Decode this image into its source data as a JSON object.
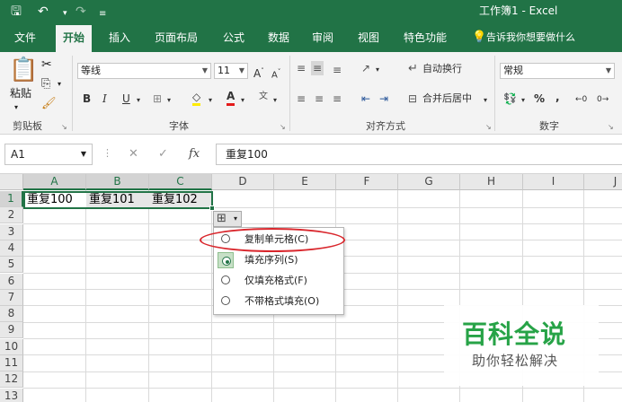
{
  "titlebar": {
    "title": "工作簿1  -  Excel",
    "save_icon": "save-icon",
    "undo_icon": "undo-icon",
    "redo_icon": "redo-icon",
    "customize_icon": "customize-toolbar-icon"
  },
  "tabs": [
    "文件",
    "开始",
    "插入",
    "页面布局",
    "公式",
    "数据",
    "审阅",
    "视图",
    "特色功能"
  ],
  "tell_me": "告诉我你想要做什么",
  "ribbon": {
    "clipboard": {
      "paste_label": "粘贴",
      "group_label": "剪贴板"
    },
    "font": {
      "font_name": "等线",
      "font_size": "11",
      "bold": "B",
      "italic": "I",
      "underline": "U",
      "grow": "A",
      "shrink": "A",
      "group_label": "字体"
    },
    "alignment": {
      "wrap_text": "自动换行",
      "merge_center": "合并后居中",
      "group_label": "对齐方式"
    },
    "number": {
      "format": "常规",
      "percent": "%",
      "comma": ",",
      "group_label": "数字"
    }
  },
  "formula_bar": {
    "name_box": "A1",
    "fx": "fx",
    "value": "重复100"
  },
  "grid": {
    "columns": [
      "A",
      "B",
      "C",
      "D",
      "E",
      "F",
      "G",
      "H",
      "I",
      "J"
    ],
    "rows": [
      "1",
      "2",
      "3",
      "4",
      "5",
      "6",
      "7",
      "8",
      "9",
      "10",
      "11",
      "12",
      "13"
    ],
    "cells": {
      "A1": "重复100",
      "B1": "重复101",
      "C1": "重复102"
    }
  },
  "autofill_menu": {
    "items": [
      {
        "label": "复制单元格(C)",
        "checked": false
      },
      {
        "label": "填充序列(S)",
        "checked": true
      },
      {
        "label": "仅填充格式(F)",
        "checked": false
      },
      {
        "label": "不带格式填充(O)",
        "checked": false
      }
    ]
  },
  "watermark": {
    "line1": "百科全说",
    "line2": "助你轻松解决"
  },
  "colors": {
    "excel_green": "#217346",
    "highlight_red": "#d9262c",
    "watermark_green": "#27a347"
  }
}
